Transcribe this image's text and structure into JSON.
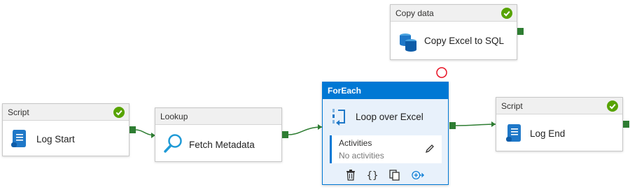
{
  "nodes": {
    "copy": {
      "type": "Copy data",
      "name": "Copy Excel to SQL"
    },
    "log_start": {
      "type": "Script",
      "name": "Log Start"
    },
    "lookup": {
      "type": "Lookup",
      "name": "Fetch Metadata"
    },
    "foreach": {
      "type": "ForEach",
      "name": "Loop over Excel",
      "activities_label": "Activities",
      "activities_value": "No activities"
    },
    "log_end": {
      "type": "Script",
      "name": "Log End"
    }
  },
  "colors": {
    "accent": "#0078d4",
    "success": "#57a300",
    "port": "#2e7d32",
    "error_ring": "#e81123"
  }
}
